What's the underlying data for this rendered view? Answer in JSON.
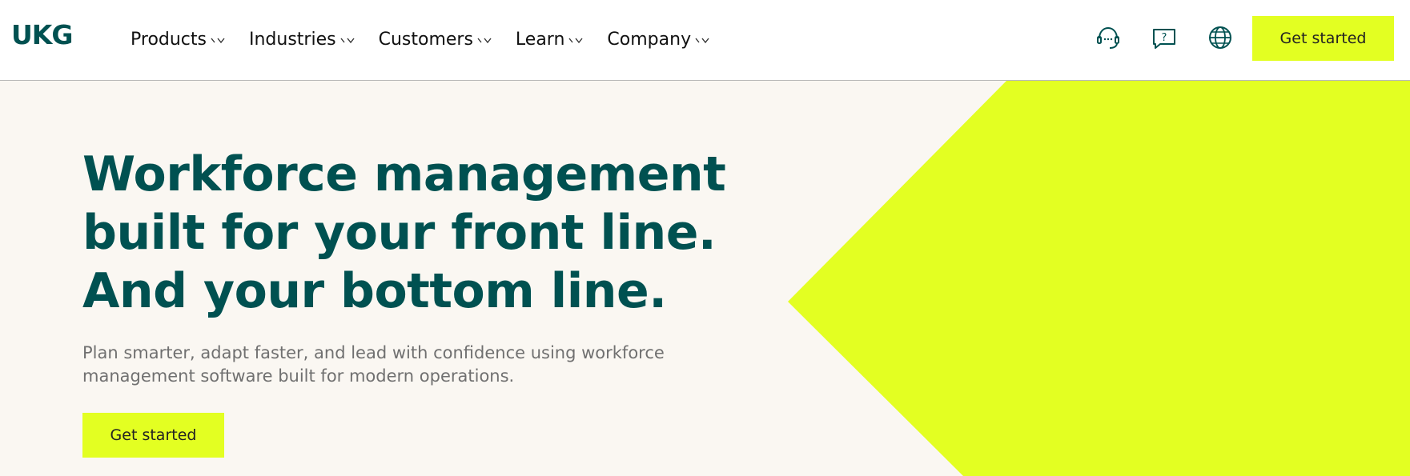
{
  "brand": {
    "logo_text": "UKG",
    "primary_color": "#005151",
    "accent_color": "#e3ff22"
  },
  "nav": {
    "items": [
      {
        "label": "Products"
      },
      {
        "label": "Industries"
      },
      {
        "label": "Customers"
      },
      {
        "label": "Learn"
      },
      {
        "label": "Company"
      }
    ]
  },
  "utility_icons": [
    "support-headset-icon",
    "help-question-icon",
    "globe-language-icon"
  ],
  "header": {
    "cta_label": "Get started"
  },
  "hero": {
    "headline_lines": [
      "Workforce management",
      "built for your front line.",
      "And your bottom line."
    ],
    "subtext_lines": [
      "Plan smarter, adapt faster, and lead with confidence using workforce",
      "management software built for modern operations."
    ],
    "cta_label": "Get started"
  }
}
